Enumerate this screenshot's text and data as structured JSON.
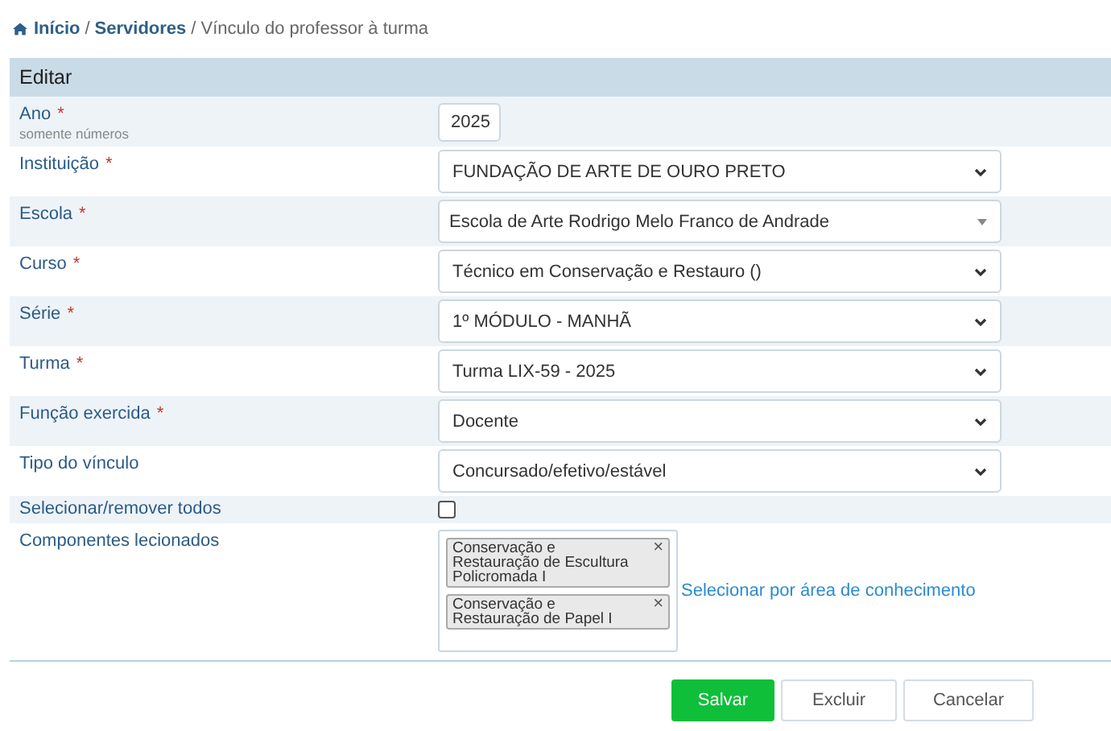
{
  "breadcrumb": [
    {
      "label": "Início",
      "kind": "link"
    },
    {
      "separator": "/",
      "label": "Servidores",
      "kind": "link"
    },
    {
      "separator": "/",
      "label": "Vínculo do professor à turma",
      "kind": "current"
    }
  ],
  "panel": {
    "title": "Editar",
    "fields": [
      {
        "label": "Ano",
        "required": "*",
        "hint": "somente números",
        "kind": "text",
        "value": "2025"
      },
      {
        "label": "Instituição",
        "required": "*",
        "kind": "select",
        "value": "FUNDAÇÃO DE ARTE DE OURO PRETO"
      },
      {
        "label": "Escola",
        "required": "*",
        "kind": "combo",
        "value": "Escola de Arte Rodrigo Melo Franco de Andrade"
      },
      {
        "label": "Curso",
        "required": "*",
        "kind": "select",
        "value": "Técnico em Conservação e Restauro ()"
      },
      {
        "label": "Série",
        "required": "*",
        "kind": "select",
        "value": "1º MÓDULO - MANHÃ"
      },
      {
        "label": "Turma",
        "required": "*",
        "kind": "select",
        "value": "Turma LIX-59 - 2025"
      },
      {
        "label": "Função exercida",
        "required": "*",
        "kind": "select",
        "value": "Docente"
      },
      {
        "label": "Tipo do vínculo",
        "kind": "select",
        "value": "Concursado/efetivo/estável"
      },
      {
        "label": "Selecionar/remover todos",
        "kind": "checkbox",
        "checked": false
      },
      {
        "label": "Componentes lecionados",
        "kind": "tags",
        "tags": [
          {
            "label": "Conservação e Restauração de Escultura Policromada I",
            "remove": "×"
          },
          {
            "label": "Conservação e Restauração de Papel I",
            "remove": "×"
          }
        ],
        "link": "Selecionar por área de conhecimento"
      }
    ]
  },
  "buttons": [
    {
      "label": "Salvar",
      "kind": "primary"
    },
    {
      "label": "Excluir",
      "kind": "default"
    },
    {
      "label": "Cancelar",
      "kind": "default"
    }
  ]
}
